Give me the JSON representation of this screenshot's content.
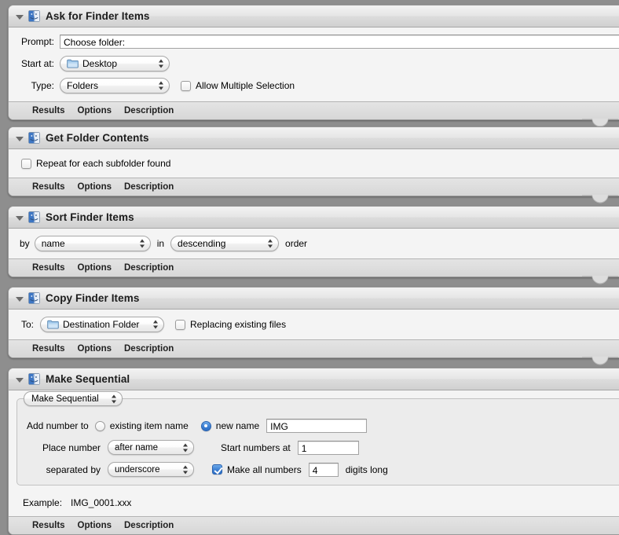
{
  "window": {
    "background_color": "#8e8e8e",
    "accent_color": "#3b7fd4"
  },
  "footer_tabs": [
    "Results",
    "Options",
    "Description"
  ],
  "actions": [
    {
      "id": "ask-for-finder-items",
      "title": "Ask for Finder Items",
      "icon": "finder-icon",
      "disclosure": "expanded",
      "fields": {
        "prompt_label": "Prompt:",
        "prompt_value": "Choose folder:",
        "start_at_label": "Start at:",
        "start_at_value": "Desktop",
        "start_at_icon": "folder-icon",
        "type_label": "Type:",
        "type_value": "Folders",
        "allow_multiple_label": "Allow Multiple Selection",
        "allow_multiple_checked": false
      }
    },
    {
      "id": "get-folder-contents",
      "title": "Get Folder Contents",
      "icon": "finder-icon",
      "disclosure": "expanded",
      "fields": {
        "repeat_label": "Repeat for each subfolder found",
        "repeat_checked": false
      }
    },
    {
      "id": "sort-finder-items",
      "title": "Sort Finder Items",
      "icon": "finder-icon",
      "disclosure": "expanded",
      "fields": {
        "by_label": "by",
        "key_value": "name",
        "in_label": "in",
        "direction_value": "descending",
        "order_label": "order"
      }
    },
    {
      "id": "copy-finder-items",
      "title": "Copy Finder Items",
      "icon": "finder-icon",
      "disclosure": "expanded",
      "fields": {
        "to_label": "To:",
        "destination_value": "Destination Folder",
        "destination_icon": "folder-icon",
        "replacing_label": "Replacing existing files",
        "replacing_checked": false
      }
    },
    {
      "id": "make-sequential",
      "title": "Make Sequential",
      "icon": "finder-icon",
      "disclosure": "expanded",
      "fields": {
        "mode_value": "Make Sequential",
        "add_number_to_label": "Add number to",
        "existing_item_name_label": "existing item name",
        "existing_item_name_selected": false,
        "new_name_label": "new name",
        "new_name_selected": true,
        "new_name_value": "IMG",
        "place_number_label": "Place number",
        "place_number_value": "after name",
        "start_numbers_at_label": "Start numbers at",
        "start_numbers_at_value": "1",
        "separated_by_label": "separated by",
        "separated_by_value": "underscore",
        "make_all_numbers_label": "Make all numbers",
        "make_all_numbers_checked": true,
        "digits_value": "4",
        "digits_long_label": "digits long",
        "example_label": "Example:",
        "example_value": "IMG_0001.xxx"
      }
    }
  ]
}
